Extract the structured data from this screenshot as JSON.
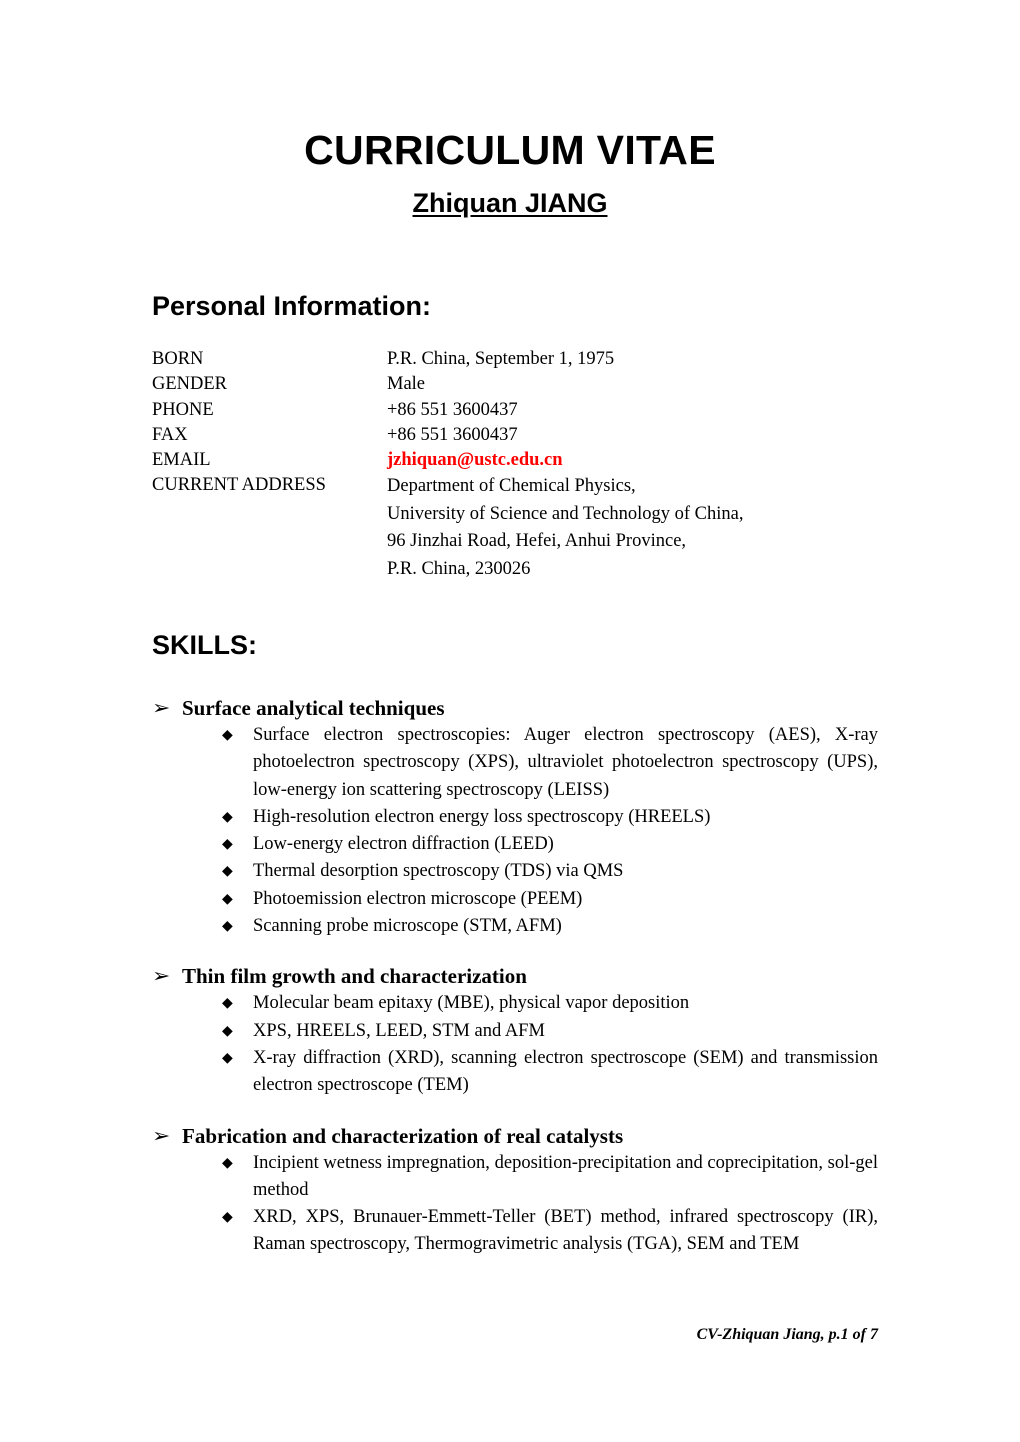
{
  "document": {
    "title": "CURRICULUM VITAE",
    "subtitle": "Zhiquan JIANG"
  },
  "personal": {
    "heading": "Personal Information:",
    "rows": [
      {
        "label": "BORN",
        "value": "P.R. China, September 1, 1975"
      },
      {
        "label": "GENDER",
        "value": "Male"
      },
      {
        "label": "PHONE",
        "value": "+86 551 3600437"
      },
      {
        "label": "FAX",
        "value": "+86 551 3600437"
      },
      {
        "label": "EMAIL",
        "value": "jzhiquan@ustc.edu.cn"
      }
    ],
    "address_label": "CURRENT ADDRESS",
    "address_lines": [
      "Department of Chemical Physics,",
      "University of Science and Technology of China,",
      "96 Jinzhai Road, Hefei, Anhui Province,",
      "P.R. China, 230026"
    ],
    "email_color": "#FF0000"
  },
  "skills": {
    "heading": "SKILLS:",
    "arrow_bullet": "➢",
    "diamond_bullet": "◆",
    "groups": [
      {
        "label": "Surface analytical techniques",
        "items": [
          "Surface electron spectroscopies: Auger electron spectroscopy (AES), X-ray photoelectron spectroscopy (XPS), ultraviolet photoelectron spectroscopy (UPS), low-energy ion scattering spectroscopy (LEISS)",
          "High-resolution electron energy loss spectroscopy (HREELS)",
          "Low-energy electron diffraction (LEED)",
          "Thermal desorption spectroscopy (TDS) via QMS",
          "Photoemission electron microscope (PEEM)",
          "Scanning probe microscope (STM, AFM)"
        ]
      },
      {
        "label": "Thin film growth and characterization",
        "items": [
          "Molecular beam epitaxy (MBE), physical vapor deposition",
          "XPS, HREELS, LEED, STM and AFM",
          "X-ray diffraction (XRD), scanning electron spectroscope (SEM) and transmission electron spectroscope (TEM)"
        ]
      },
      {
        "label": "Fabrication and characterization of real catalysts",
        "items": [
          "Incipient wetness impregnation, deposition-precipitation and coprecipitation, sol-gel method",
          "XRD, XPS, Brunauer-Emmett-Teller (BET) method, infrared spectroscopy (IR), Raman spectroscopy, Thermogravimetric analysis (TGA), SEM and TEM"
        ]
      }
    ]
  },
  "footer": {
    "text": "CV-Zhiquan Jiang, p.1 of 7"
  }
}
